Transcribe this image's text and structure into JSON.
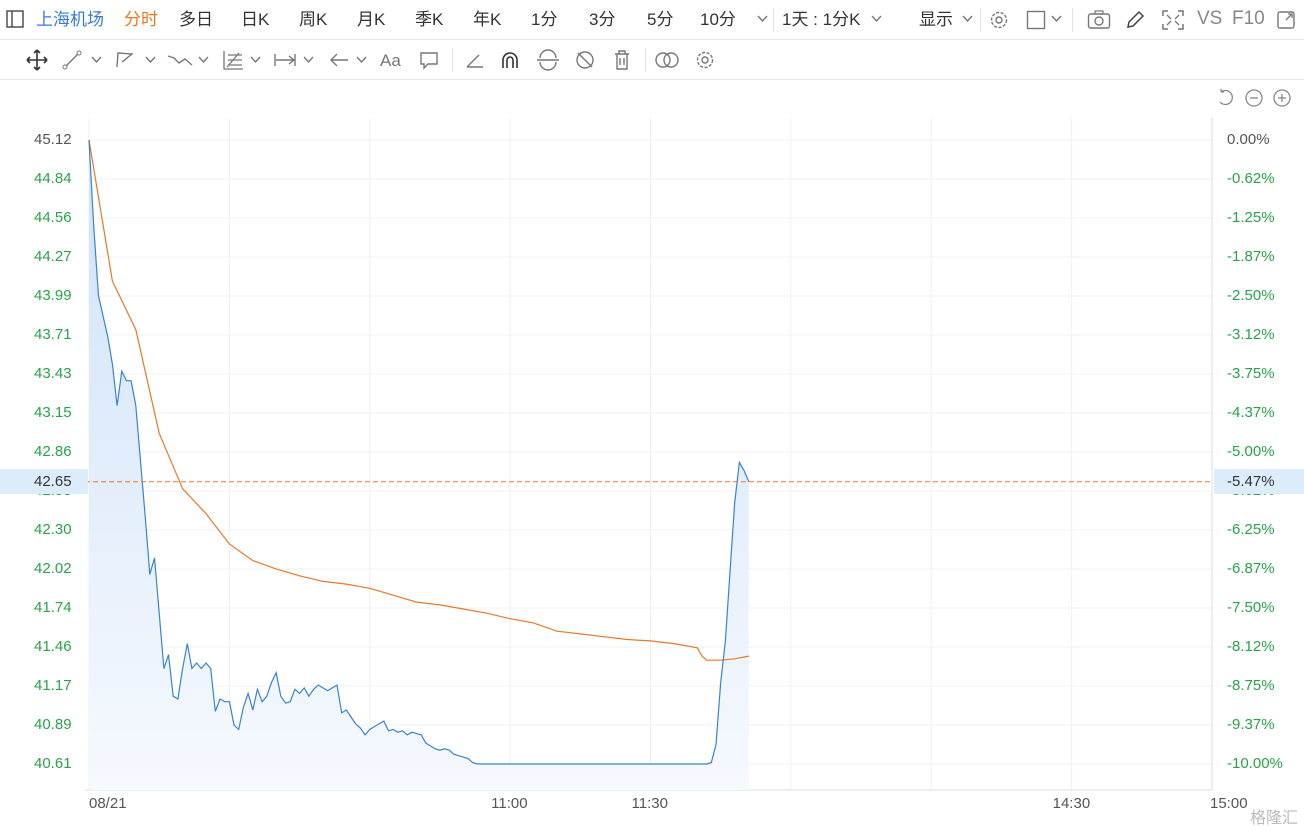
{
  "header": {
    "stock_name": "上海机场",
    "tabs": [
      "分时",
      "多日",
      "日K",
      "周K",
      "月K",
      "季K",
      "年K",
      "1分",
      "3分",
      "5分",
      "10分"
    ],
    "active_tab": "分时",
    "period_label": "1天 : 1分K",
    "display_label": "显示",
    "vs_label": "VS",
    "f10_label": "F10"
  },
  "colors": {
    "price": "#3a82d2",
    "avg": "#e8782a",
    "up": "#2aa24a",
    "ref": "#e8782a"
  },
  "chart_data": {
    "type": "line",
    "x_label": "",
    "y_label": "",
    "prev_close": 45.12,
    "current_price": "42.65",
    "current_pct": "-5.47%",
    "y_ticks": [
      "45.12",
      "44.84",
      "44.56",
      "44.27",
      "43.99",
      "43.71",
      "43.43",
      "43.15",
      "42.86",
      "42.58",
      "42.30",
      "42.02",
      "41.74",
      "41.46",
      "41.17",
      "40.89",
      "40.61"
    ],
    "pct_ticks": [
      "0.00%",
      "-0.62%",
      "-1.25%",
      "-1.87%",
      "-2.50%",
      "-3.12%",
      "-3.75%",
      "-4.37%",
      "-5.00%",
      "-5.62%",
      "-6.25%",
      "-6.87%",
      "-7.50%",
      "-8.12%",
      "-8.75%",
      "-9.37%",
      "-10.00%"
    ],
    "x_ticks": [
      {
        "label": "08/21",
        "minute": 0
      },
      {
        "label": "11:00",
        "minute": 90
      },
      {
        "label": "11:30",
        "minute": 120
      },
      {
        "label": "14:30",
        "minute": 210
      },
      {
        "label": "15:00",
        "minute": 240
      }
    ],
    "ylim": [
      40.61,
      45.12
    ],
    "total_minutes": 240,
    "series": [
      {
        "key": "price",
        "x": [
          0,
          1,
          2,
          3,
          4,
          5,
          6,
          7,
          8,
          9,
          10,
          11,
          12,
          13,
          14,
          15,
          16,
          17,
          18,
          19,
          20,
          21,
          22,
          23,
          24,
          25,
          26,
          27,
          28,
          29,
          30,
          31,
          32,
          33,
          34,
          35,
          36,
          37,
          38,
          39,
          40,
          41,
          42,
          43,
          44,
          45,
          46,
          47,
          48,
          49,
          50,
          51,
          52,
          53,
          54,
          55,
          56,
          57,
          58,
          59,
          60,
          61,
          62,
          63,
          64,
          65,
          66,
          67,
          68,
          69,
          70,
          71,
          72,
          73,
          74,
          75,
          76,
          77,
          78,
          79,
          80,
          81,
          82,
          83,
          84,
          85,
          86,
          87,
          88,
          89,
          90,
          91,
          92,
          93,
          94,
          95,
          96,
          97,
          98,
          99,
          100,
          101,
          102,
          103,
          104,
          105,
          106,
          107,
          108,
          109,
          110,
          111,
          112,
          113,
          114,
          115,
          116,
          117,
          118,
          119,
          120,
          121,
          122,
          123,
          124,
          125,
          126,
          127,
          128,
          129,
          130,
          131,
          132,
          133,
          134,
          135,
          136,
          137,
          138,
          139,
          140,
          141
        ],
        "values": [
          45.12,
          44.5,
          44.0,
          43.85,
          43.7,
          43.5,
          43.2,
          43.45,
          43.38,
          43.38,
          43.2,
          42.8,
          42.4,
          41.98,
          42.1,
          41.7,
          41.3,
          41.4,
          41.1,
          41.08,
          41.3,
          41.48,
          41.3,
          41.34,
          41.3,
          41.34,
          41.3,
          40.99,
          41.08,
          41.06,
          41.06,
          40.89,
          40.86,
          41.02,
          41.12,
          41.0,
          41.15,
          41.06,
          41.1,
          41.2,
          41.27,
          41.1,
          41.05,
          41.06,
          41.15,
          41.12,
          41.16,
          41.1,
          41.15,
          41.18,
          41.16,
          41.14,
          41.16,
          41.18,
          40.98,
          41.0,
          40.95,
          40.9,
          40.87,
          40.82,
          40.86,
          40.88,
          40.9,
          40.92,
          40.85,
          40.86,
          40.84,
          40.85,
          40.82,
          40.84,
          40.83,
          40.82,
          40.76,
          40.74,
          40.72,
          40.71,
          40.72,
          40.71,
          40.68,
          40.67,
          40.66,
          40.65,
          40.62,
          40.61,
          40.61,
          40.61,
          40.61,
          40.61,
          40.61,
          40.61,
          40.61,
          40.61,
          40.61,
          40.61,
          40.61,
          40.61,
          40.61,
          40.61,
          40.61,
          40.61,
          40.61,
          40.61,
          40.61,
          40.61,
          40.61,
          40.61,
          40.61,
          40.61,
          40.61,
          40.61,
          40.61,
          40.61,
          40.61,
          40.61,
          40.61,
          40.61,
          40.61,
          40.61,
          40.61,
          40.61,
          40.61,
          40.61,
          40.61,
          40.61,
          40.61,
          40.61,
          40.61,
          40.61,
          40.61,
          40.61,
          40.61,
          40.61,
          40.61,
          40.62,
          40.75,
          41.2,
          41.5,
          42.0,
          42.5,
          42.79,
          42.73,
          42.65
        ]
      },
      {
        "key": "avg",
        "x": [
          0,
          5,
          10,
          15,
          20,
          25,
          30,
          35,
          40,
          45,
          50,
          55,
          60,
          65,
          70,
          75,
          80,
          85,
          90,
          95,
          100,
          105,
          110,
          115,
          120,
          125,
          130,
          131,
          132,
          135,
          138,
          141
        ],
        "values": [
          45.12,
          44.1,
          43.75,
          43.0,
          42.6,
          42.42,
          42.2,
          42.08,
          42.02,
          41.97,
          41.93,
          41.91,
          41.88,
          41.83,
          41.78,
          41.76,
          41.73,
          41.7,
          41.66,
          41.63,
          41.57,
          41.55,
          41.53,
          41.51,
          41.5,
          41.48,
          41.45,
          41.39,
          41.36,
          41.36,
          41.37,
          41.39
        ]
      }
    ]
  },
  "watermark": "格隆汇"
}
